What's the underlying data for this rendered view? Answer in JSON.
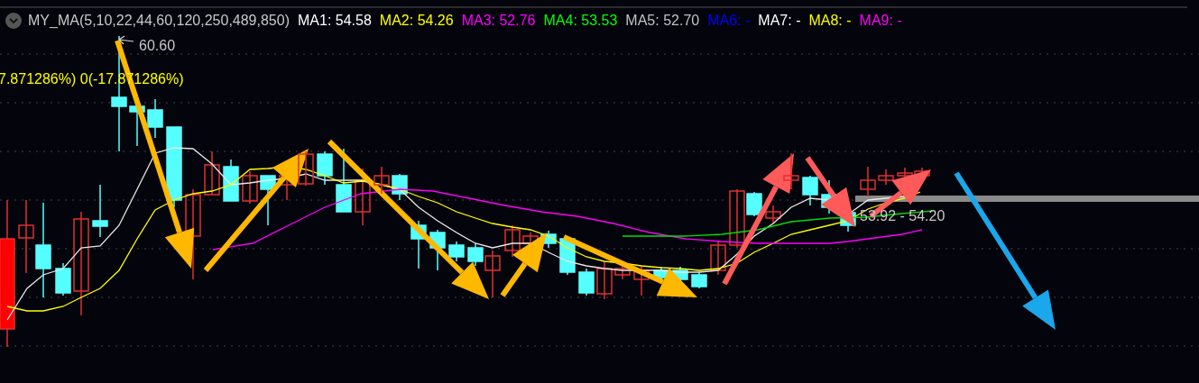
{
  "indicator": {
    "name": "MY_MA(5,10,22,44,60,120,250,489,850)",
    "collapsed": true
  },
  "ma_values": [
    {
      "label": "MA1:",
      "value": "54.58",
      "color": "#ffffff"
    },
    {
      "label": "MA2:",
      "value": "54.26",
      "color": "#ffff00"
    },
    {
      "label": "MA3:",
      "value": "52.76",
      "color": "#ff00ff"
    },
    {
      "label": "MA4:",
      "value": "53.53",
      "color": "#00ff00"
    },
    {
      "label": "MA5:",
      "value": "52.70",
      "color": "#c0c0c0"
    },
    {
      "label": "MA6:",
      "value": "-",
      "color": "#0000ff"
    },
    {
      "label": "MA7:",
      "value": "-",
      "color": "#ffffff"
    },
    {
      "label": "MA8:",
      "value": "-",
      "color": "#ffff00"
    },
    {
      "label": "MA9:",
      "value": "-",
      "color": "#ff00ff"
    }
  ],
  "chart": {
    "high_label": "60.60",
    "range_label": "7.871286%) 0(-17.871286%)",
    "price_label": "53.92 - 54.20"
  }
}
